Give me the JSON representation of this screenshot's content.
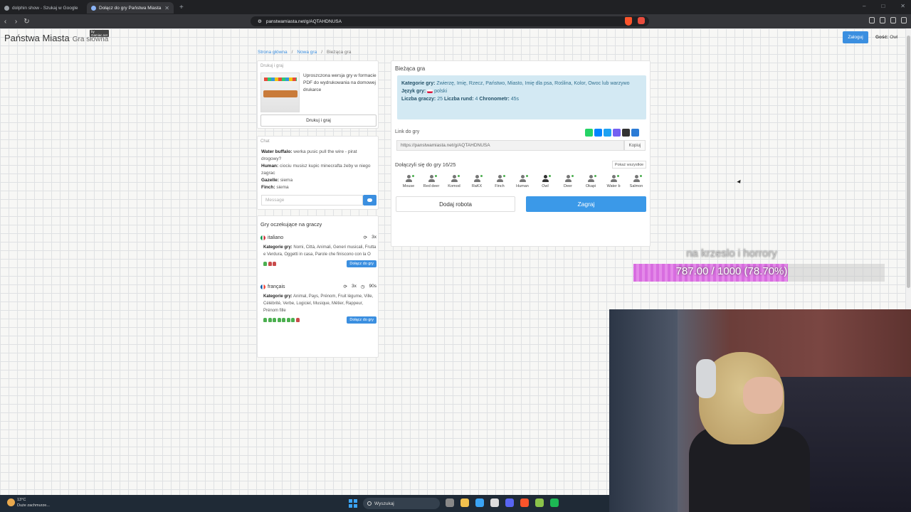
{
  "browser": {
    "tabs": [
      {
        "label": "dolphin show - Szukaj w Google",
        "active": false
      },
      {
        "label": "Dołącz do gry Państwa Miasta",
        "active": true
      }
    ],
    "url": "panstwamiasta.net/g/AQTAHDNUSA"
  },
  "site": {
    "title": "Państwa Miasta",
    "subtitle": "Gra słowna",
    "by_badge": "by Gamiac.net",
    "login_label": "Zaloguj",
    "guest_label": "Gość:",
    "guest_name": "Owl"
  },
  "breadcrumb": [
    "Strona główna",
    "Nowa gra",
    "Bieżąca gra"
  ],
  "print_card": {
    "title": "Drukuj i graj",
    "description": "Uproszczona wersja gry w formacie PDF do wydrukowania na domowej drukarce",
    "button": "Drukuj i graj"
  },
  "chat": {
    "title": "Chat",
    "messages": [
      {
        "author": "Water buffalo:",
        "text": "werka pusic pull the wire - pirat drogowy?"
      },
      {
        "author": "Human:",
        "text": "ciociu musisz kupic minecrafta żeby w niego zagrac"
      },
      {
        "author": "Gazelle:",
        "text": "siema"
      },
      {
        "author": "Finch:",
        "text": "siema"
      }
    ],
    "placeholder": "Message"
  },
  "waiting_games": {
    "title": "Gry oczekujące na graczy",
    "categories_label": "Kategorie gry:",
    "join_label": "Dołącz do gry",
    "games": [
      {
        "language": "italiano",
        "rounds": "3x",
        "timer": "",
        "categories": "Nomi, Città, Animali, Generi musicali, Frutta e Verdura, Oggetti in casa, Parole che finiscono con la O",
        "players_on": 1,
        "players_off": 2
      },
      {
        "language": "français",
        "rounds": "3x",
        "timer": "90s",
        "categories": "Animal, Pays, Prénom, Fruit légume, Ville, Célébrité, Verbe, Logiciel, Musique, Métier, Rappeur, Prénom fille",
        "players_on": 7,
        "players_off": 1
      }
    ]
  },
  "current_game": {
    "title": "Bieżąca gra",
    "categories_label": "Kategorie gry:",
    "categories": "Zwierzę, Imię, Rzecz, Państwo, Miasto, Imię dla psa, Roślina, Kolor, Owoc lub warzywo",
    "language_label": "Język gry:",
    "language": "polski",
    "players_count_label": "Liczba graczy:",
    "players_count": "25",
    "rounds_label": "Liczba rund:",
    "rounds": "4",
    "timer_label": "Chronometr:",
    "timer": "45s",
    "link_label": "Link do gry",
    "link": "https://panstwamiasta.net/g/AQTAHDNUSA",
    "copy_label": "Kopiuj",
    "joined_label": "Dołączyli się do gry 16/25",
    "show_all_label": "Pokaż wszystkie",
    "players": [
      "Mouse",
      "Red deer",
      "Komod",
      "RaKX",
      "Finch",
      "Human",
      "Owl",
      "Deer",
      "Okapi",
      "Water b",
      "Salmon"
    ],
    "add_robot_label": "Dodaj robota",
    "play_label": "Zagraj",
    "share_colors": [
      "#25d366",
      "#0084ff",
      "#1da1f2",
      "#7360f2",
      "#333333",
      "#2b7bd6"
    ]
  },
  "overlay": {
    "goal_text": "na krzeslo i horrory",
    "progress_text": "787.00 / 1000 (78.70%)",
    "progress": 0.787
  },
  "taskbar": {
    "temperature": "13°C",
    "weather": "Duże zachmurze...",
    "search_label": "Wyszukaj",
    "icon_colors": [
      "#888888",
      "#f2c14e",
      "#3ba4f5",
      "#dddddd",
      "#5865f2",
      "#fb542b",
      "#8bc34a",
      "#1db954"
    ]
  }
}
